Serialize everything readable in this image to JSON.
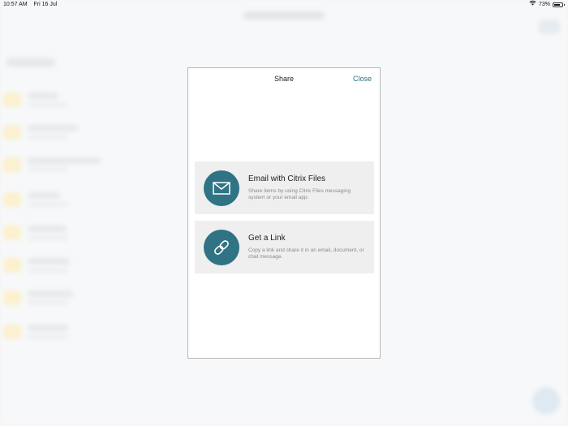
{
  "status_bar": {
    "time": "10:57 AM",
    "date": "Fri 16 Jul",
    "battery_percent": "73%",
    "battery_level": 0.73
  },
  "dialog": {
    "title": "Share",
    "close_label": "Close",
    "options": [
      {
        "title": "Email with Citrix Files",
        "description": "Share items by using Citrix Files messaging system or your email app.",
        "icon": "envelope-icon"
      },
      {
        "title": "Get a Link",
        "description": "Copy a link and share it in an email, document, or chat message.",
        "icon": "link-icon"
      }
    ]
  },
  "colors": {
    "accent": "#2f7385",
    "close_text": "#2d6f86",
    "card_background": "#efefef"
  }
}
